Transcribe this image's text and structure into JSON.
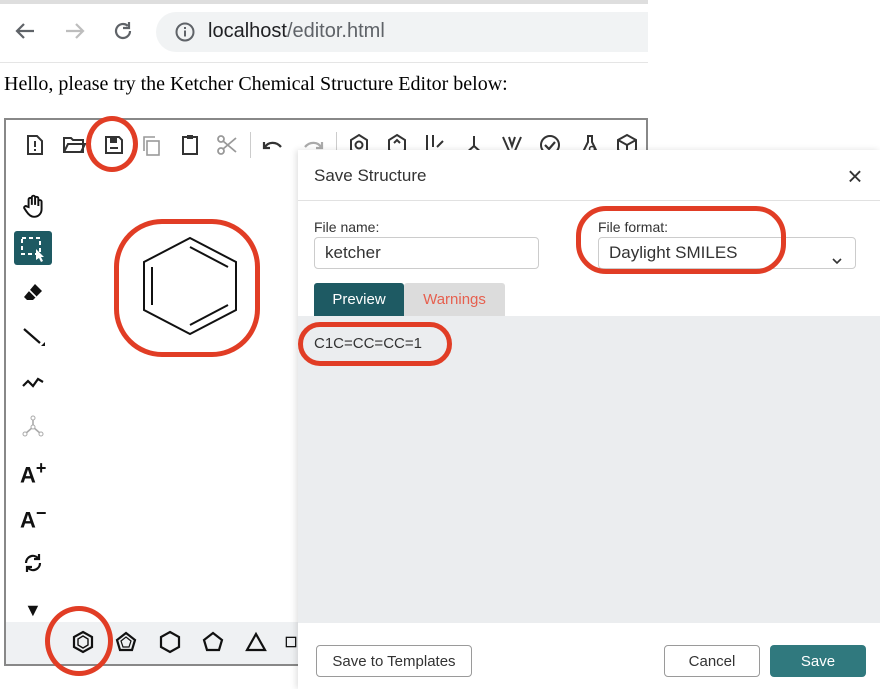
{
  "browser": {
    "url_host": "localhost",
    "url_path": "/editor.html",
    "icons": [
      "back-arrow-icon",
      "forward-arrow-icon",
      "reload-icon",
      "info-icon"
    ]
  },
  "page": {
    "intro_text": "Hello, please try the Ketcher Chemical Structure Editor below:"
  },
  "ketcher": {
    "top_toolbar": [
      "new-document-icon",
      "open-folder-icon",
      "save-icon",
      "copy-icon",
      "paste-icon",
      "cut-icon",
      "undo-icon",
      "redo-icon",
      "layout-icon",
      "clean-icon",
      "aromatize-icon",
      "dearomatize-icon",
      "calculate-cip-icon",
      "check-icon",
      "analyse-icon",
      "3d-viewer-icon"
    ],
    "left_toolbar": [
      "hand-icon",
      "select-icon",
      "eraser-icon",
      "bond-icon",
      "chain-icon",
      "sgroup-icon",
      "charge-plus-icon",
      "charge-minus-icon",
      "rotate-icon",
      "more-arrow-icon"
    ],
    "bottom_toolbar": [
      "benzene-template-icon",
      "cyclopentadiene-template-icon",
      "cyclohexane-template-icon",
      "cyclopentane-template-icon",
      "cyclopropane-template-icon",
      "cyclobutane-template-icon"
    ],
    "canvas_structure": "benzene",
    "highlight_color": "#e13d25"
  },
  "dialog": {
    "title": "Save Structure",
    "file_name_label": "File name:",
    "file_name_value": "ketcher",
    "file_format_label": "File format:",
    "file_format_value": "Daylight SMILES",
    "tabs": [
      {
        "label": "Preview",
        "active": true
      },
      {
        "label": "Warnings",
        "active": false
      }
    ],
    "preview_text": "C1C=CC=CC=1",
    "buttons": {
      "save_to_templates": "Save to Templates",
      "cancel": "Cancel",
      "save": "Save"
    },
    "colors": {
      "active_tab": "#1e5a63",
      "save_button": "#30797e",
      "warnings_text": "#e6604f"
    }
  }
}
